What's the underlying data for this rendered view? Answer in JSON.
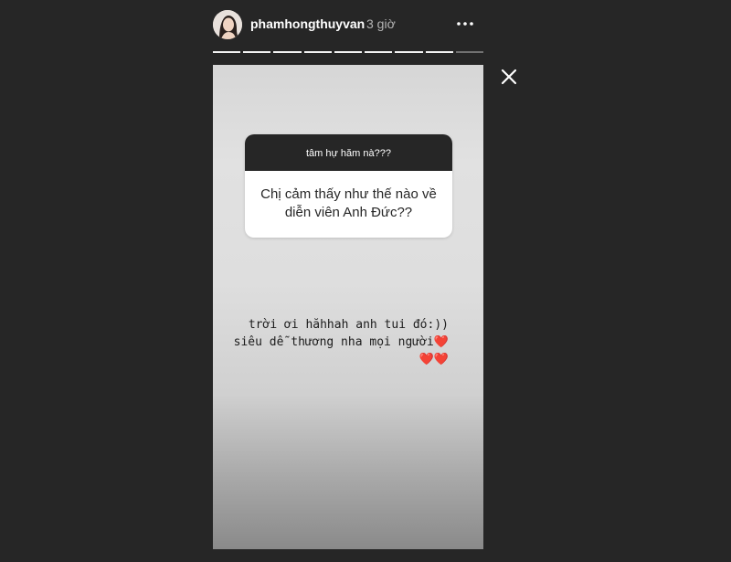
{
  "header": {
    "username": "phamhongthuyvan",
    "time": "3 giờ",
    "avatar_icon": "profile-photo",
    "more_icon": "more-horizontal-icon"
  },
  "progress": {
    "total_segments": 9,
    "completed_segments": 8
  },
  "close_icon": "close-icon",
  "question_box": {
    "header": "tâm hự hăm nà???",
    "question": "Chị cảm thấy như thế nào về diễn viên Anh Đức??"
  },
  "answer": {
    "text": "trời ơi hăhhah anh tui đó:)) siêu dễ thương nha mọi người❤️❤️❤️"
  },
  "colors": {
    "background": "#262626",
    "question_header": "#262626",
    "question_body": "#ffffff",
    "text_on_story": "#1c1c1c"
  }
}
